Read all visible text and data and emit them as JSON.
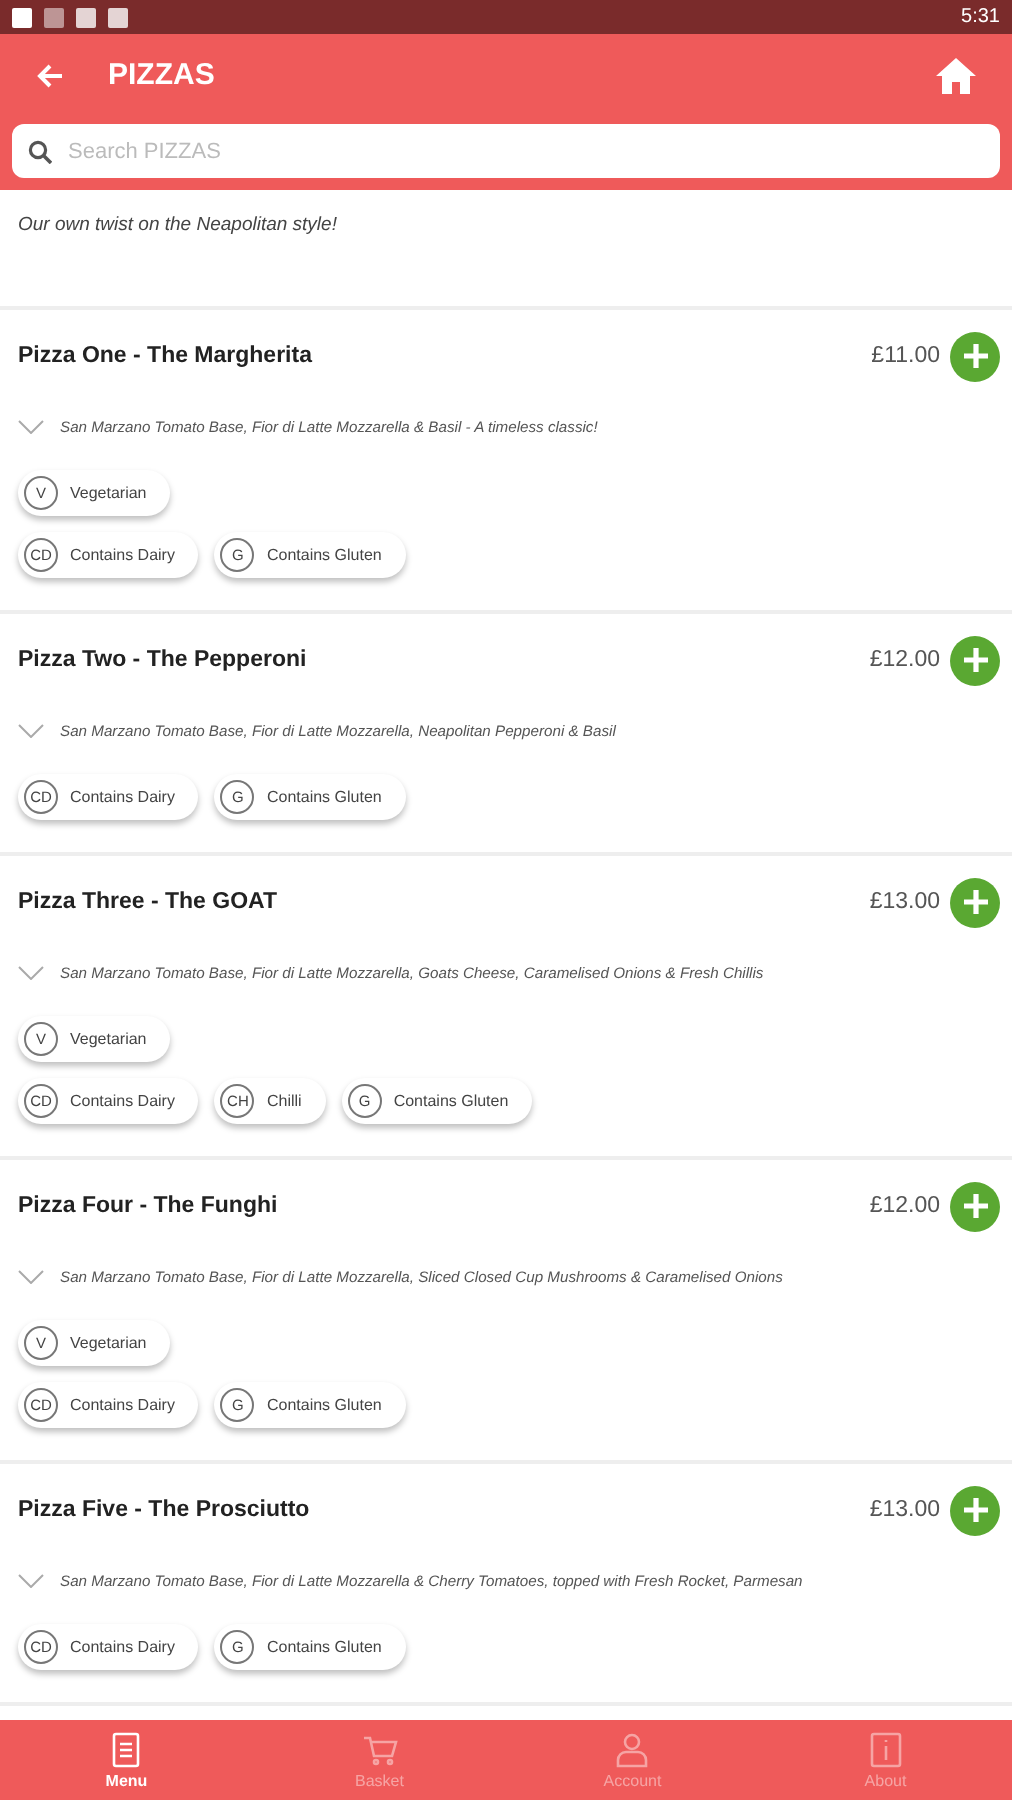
{
  "status_bar": {
    "time": "5:31"
  },
  "header": {
    "title": "PIZZAS"
  },
  "search": {
    "placeholder": "Search PIZZAS"
  },
  "category_description": "Our own twist on the Neapolitan style!",
  "items": [
    {
      "name": "Pizza One - The Margherita",
      "price": "£11.00",
      "description": "San Marzano Tomato Base, Fior di Latte Mozzarella & Basil - A timeless classic!",
      "tag_rows": [
        [
          {
            "code": "V",
            "label": "Vegetarian"
          }
        ],
        [
          {
            "code": "CD",
            "label": "Contains Dairy"
          },
          {
            "code": "G",
            "label": "Contains Gluten"
          }
        ]
      ]
    },
    {
      "name": "Pizza Two - The Pepperoni",
      "price": "£12.00",
      "description": "San Marzano Tomato Base, Fior di Latte Mozzarella, Neapolitan Pepperoni & Basil",
      "tag_rows": [
        [
          {
            "code": "CD",
            "label": "Contains Dairy"
          },
          {
            "code": "G",
            "label": "Contains Gluten"
          }
        ]
      ]
    },
    {
      "name": "Pizza Three - The GOAT",
      "price": "£13.00",
      "description": "San Marzano Tomato Base, Fior di Latte Mozzarella, Goats Cheese, Caramelised Onions & Fresh Chillis",
      "tag_rows": [
        [
          {
            "code": "V",
            "label": "Vegetarian"
          }
        ],
        [
          {
            "code": "CD",
            "label": "Contains Dairy"
          },
          {
            "code": "CH",
            "label": "Chilli"
          },
          {
            "code": "G",
            "label": "Contains Gluten"
          }
        ]
      ]
    },
    {
      "name": "Pizza Four - The Funghi",
      "price": "£12.00",
      "description": "San Marzano Tomato Base, Fior di Latte Mozzarella, Sliced Closed Cup Mushrooms & Caramelised Onions",
      "tag_rows": [
        [
          {
            "code": "V",
            "label": "Vegetarian"
          }
        ],
        [
          {
            "code": "CD",
            "label": "Contains Dairy"
          },
          {
            "code": "G",
            "label": "Contains Gluten"
          }
        ]
      ]
    },
    {
      "name": "Pizza Five - The Prosciutto",
      "price": "£13.00",
      "description": "San Marzano Tomato Base, Fior di Latte Mozzarella & Cherry Tomatoes, topped with Fresh Rocket, Parmesan",
      "tag_rows": [
        [
          {
            "code": "CD",
            "label": "Contains Dairy"
          },
          {
            "code": "G",
            "label": "Contains Gluten"
          }
        ]
      ]
    }
  ],
  "nav": [
    {
      "kind": "menu",
      "label": "Menu",
      "selected": true
    },
    {
      "kind": "basket",
      "label": "Basket",
      "selected": false
    },
    {
      "kind": "account",
      "label": "Account",
      "selected": false
    },
    {
      "kind": "about",
      "label": "About",
      "selected": false
    }
  ]
}
